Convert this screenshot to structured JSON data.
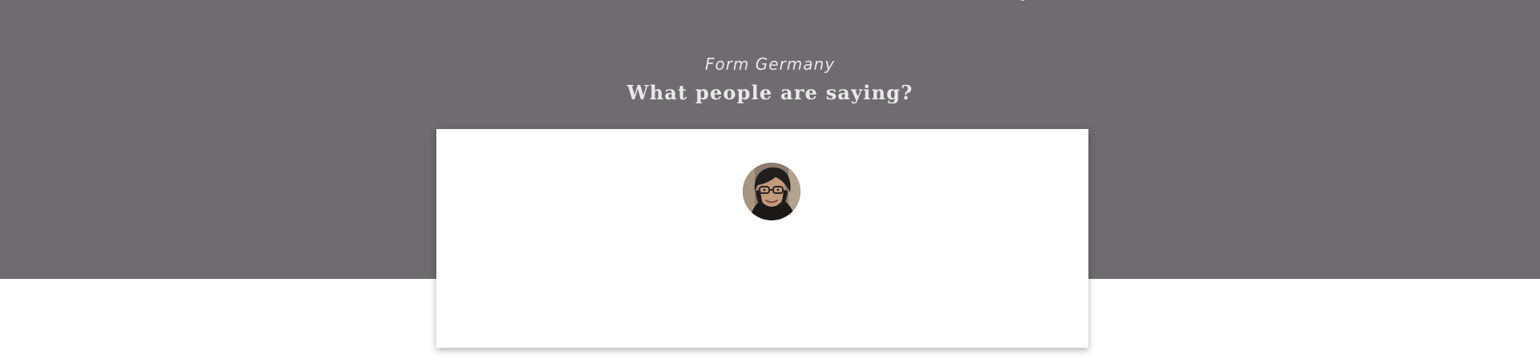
{
  "testimonials": {
    "eyebrow": "Form Germany",
    "title": "What people are saying?",
    "avatar_icon": "person-avatar-icon"
  }
}
